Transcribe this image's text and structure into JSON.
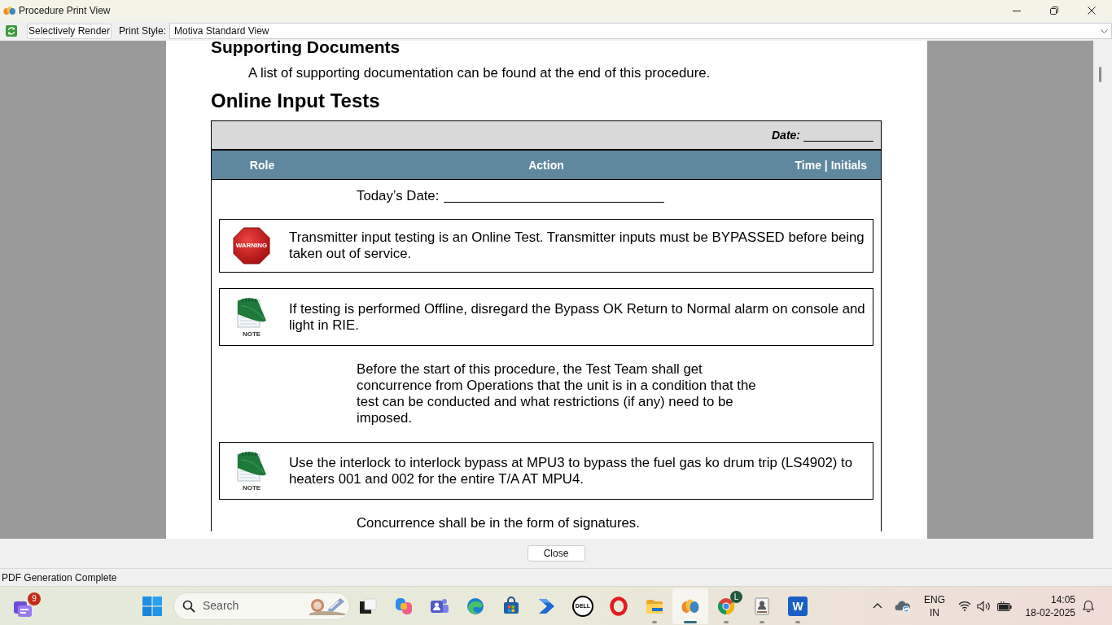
{
  "window": {
    "title": "Procedure Print View"
  },
  "toolbar": {
    "render_button": "Selectively Render",
    "print_style_label": "Print Style:",
    "print_style": "Motiva Standard View"
  },
  "document": {
    "sections": [
      {
        "heading": "Supporting Documents",
        "text": "A list of supporting documentation can be found at the end of this procedure."
      },
      {
        "heading": "Online Input Tests"
      }
    ],
    "table": {
      "date_label": "Date:",
      "columns": [
        "Role",
        "Action",
        "Time | Initials"
      ],
      "rows": [
        {
          "kind": "fill_in",
          "label": "Today’s Date:"
        },
        {
          "kind": "warning",
          "badge": "WARNING",
          "text": "Transmitter input testing is an Online Test. Transmitter inputs must be BYPASSED before being taken out of service."
        },
        {
          "kind": "note",
          "badge": "NOTE",
          "text": "If testing is performed Offline, disregard the Bypass OK Return to Normal alarm on console and light in RIE."
        },
        {
          "kind": "text",
          "text": "Before the start of this procedure, the Test Team shall get concurrence from Operations that the unit is in a condition that the test can be conducted and what restrictions (if any) need to be imposed."
        },
        {
          "kind": "note",
          "badge": "NOTE",
          "text": "Use the interlock to interlock bypass at MPU3 to bypass the fuel gas ko drum trip (LS4902) to heaters 001 and 002 for the entire T/A AT MPU4."
        },
        {
          "kind": "text",
          "text": "Concurrence shall be in the form of signatures."
        }
      ]
    }
  },
  "footer": {
    "close_button": "Close"
  },
  "status_bar": {
    "text": "PDF Generation Complete"
  },
  "taskbar": {
    "widget_badge": "9",
    "search_placeholder": "Search",
    "apps": [
      {
        "kind": "task_view",
        "running": false,
        "active": false
      },
      {
        "kind": "knot",
        "running": false,
        "active": false
      },
      {
        "kind": "people",
        "running": false,
        "active": false
      },
      {
        "kind": "wave",
        "running": false,
        "active": false
      },
      {
        "kind": "bag",
        "running": false,
        "active": false
      },
      {
        "kind": "chevron",
        "running": false,
        "active": false
      },
      {
        "kind": "logo",
        "label": "DELL",
        "running": false,
        "active": false
      },
      {
        "kind": "ring",
        "running": false,
        "active": false
      },
      {
        "kind": "folder",
        "running": true,
        "active": false
      },
      {
        "kind": "blobs",
        "running": true,
        "active": true
      },
      {
        "kind": "browser",
        "badge": "L",
        "running": true,
        "active": false
      },
      {
        "kind": "portrait",
        "running": true,
        "active": false
      },
      {
        "kind": "tile",
        "label": "W",
        "running": true,
        "active": false
      }
    ],
    "tray": {
      "language": "ENG",
      "region": "IN",
      "time": "14:05",
      "date": "18-02-2025"
    }
  }
}
